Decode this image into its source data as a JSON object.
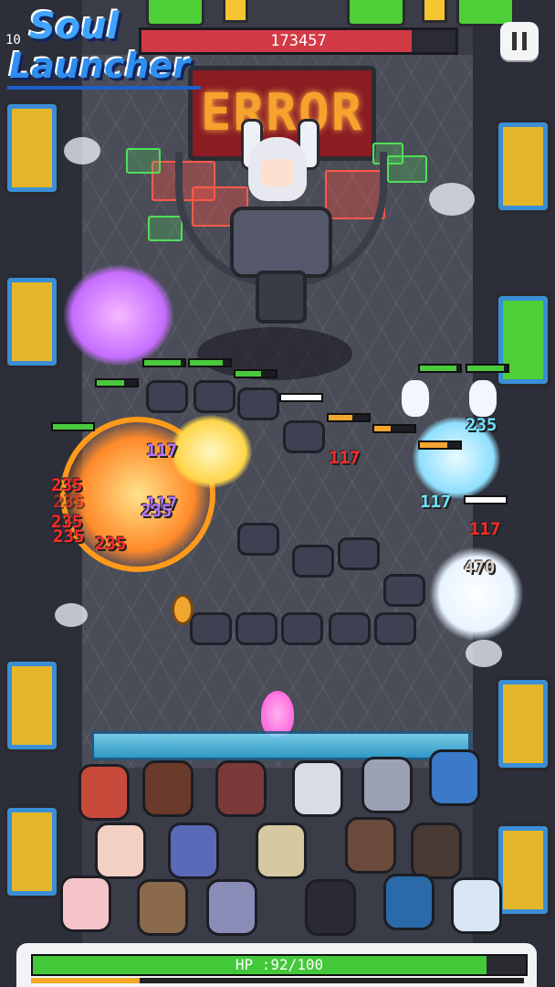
{
  "game": {
    "logo_line1": "Soul",
    "logo_line2": "Launcher",
    "level_prefix": "10",
    "boss_hp_value": "173457",
    "boss_hp_fraction": 0.86,
    "boss_screen_text": "ERROR",
    "player_hp_label": "HP :92/100",
    "player_hp_fraction": 0.92,
    "xp_fraction": 0.22,
    "pause_icon": "pause-icon"
  },
  "damage_numbers": {
    "d1": "117",
    "d2": "235",
    "d3": "235",
    "d4": "117",
    "d5": "235",
    "d6": "235",
    "d7": "235",
    "d8": "117",
    "d9": "117",
    "d10": "235",
    "d11": "117",
    "d12": "235",
    "d13": "470",
    "d14": "117"
  },
  "colors": {
    "boss_hp": "#d23a45",
    "player_hp": "#43c83a",
    "xp": "#f3a927",
    "error_text": "#f6a22c"
  }
}
